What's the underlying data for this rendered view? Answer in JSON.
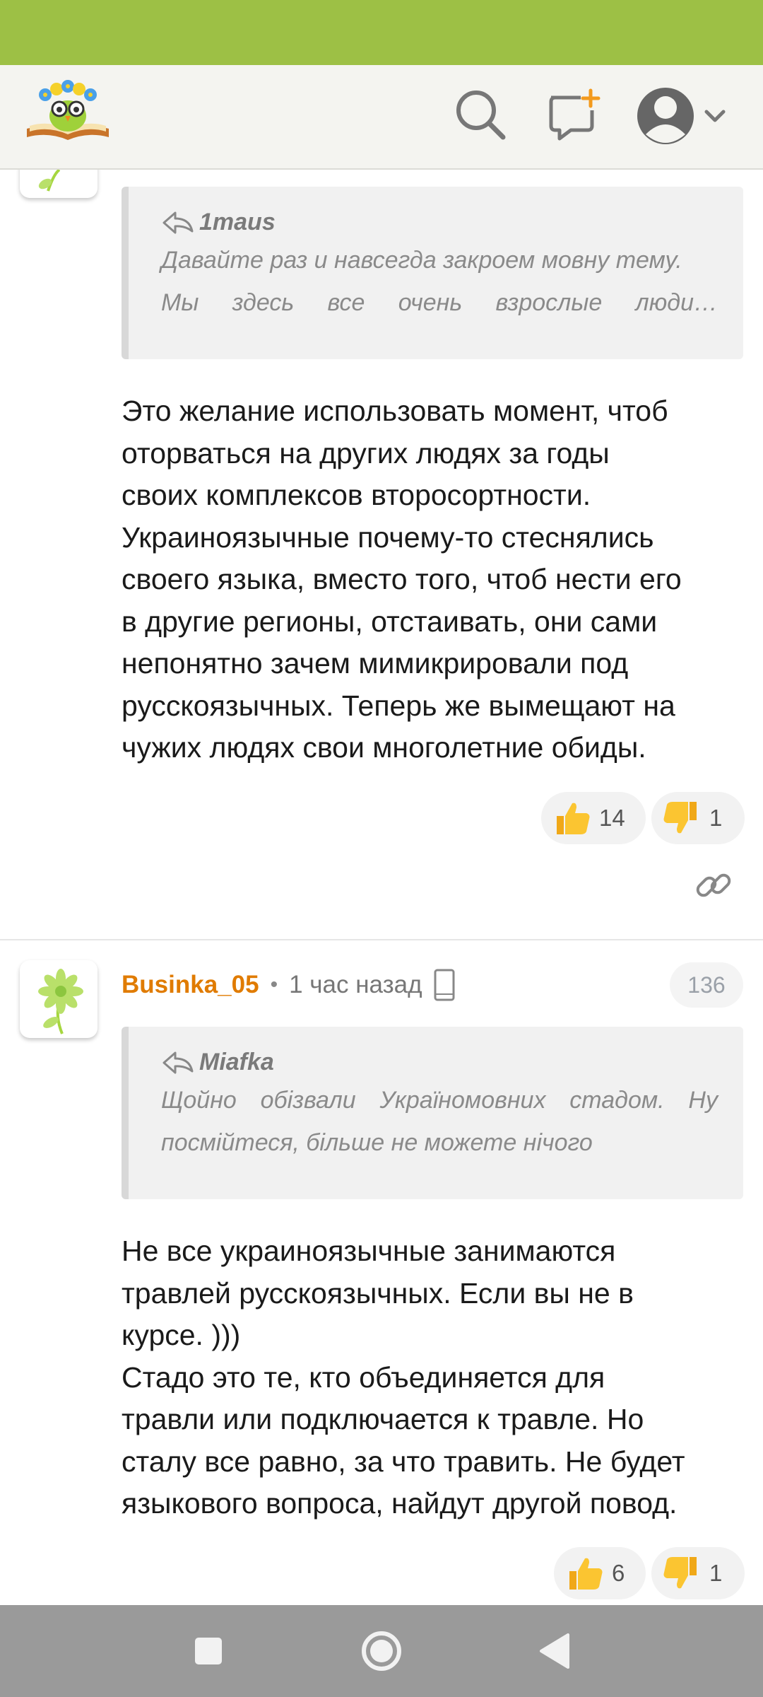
{
  "colors": {
    "status_bar": "#9dc045",
    "username": "#e07b00",
    "nav_bar": "#9a9a9a"
  },
  "header": {
    "logo": "owl-book-logo",
    "icons": [
      "search-icon",
      "new-post-icon",
      "account-avatar-icon",
      "chevron-down-icon"
    ]
  },
  "comments": [
    {
      "quote_author": "1maus",
      "quote_lines": [
        "Давайте раз и навсегда закроем мовну тему.",
        "Мы здесь все очень взрослые люди…"
      ],
      "text_lines": [
        "Это желание использовать момент, чтоб",
        "оторваться на других людях за годы",
        "своих комплексов второсортности.",
        "Украиноязычные почему-то стеснялись",
        "своего языка, вместо того, чтоб нести его",
        "в другие регионы, отстаивать, они сами",
        "непонятно зачем мимикрировали под",
        "русскоязычных. Теперь же вымещают на",
        "чужих людях свои многолетние обиды."
      ],
      "likes": "14",
      "dislikes": "1"
    },
    {
      "username": "Businka_05",
      "separator": "•",
      "time": "1 час назад",
      "badge": "136",
      "quote_author": "Miafka",
      "quote_lines": [
        "Щойно обізвали Україномовних стадом. Ну",
        "посмійтеся, більше не можете нічого"
      ],
      "text_lines": [
        "Не все украиноязычные занимаются",
        "травлей русскоязычных. Если вы не в",
        "курсе. )))",
        "Стадо это те, кто объединяется для",
        "травли или подключается к травле. Но",
        "сталу все равно, за что травить. Не будет",
        "языкового вопроса, найдут другой повод."
      ],
      "likes": "6",
      "dislikes": "1"
    }
  ],
  "nav": [
    "recents-square-icon",
    "home-circle-icon",
    "back-triangle-icon"
  ]
}
